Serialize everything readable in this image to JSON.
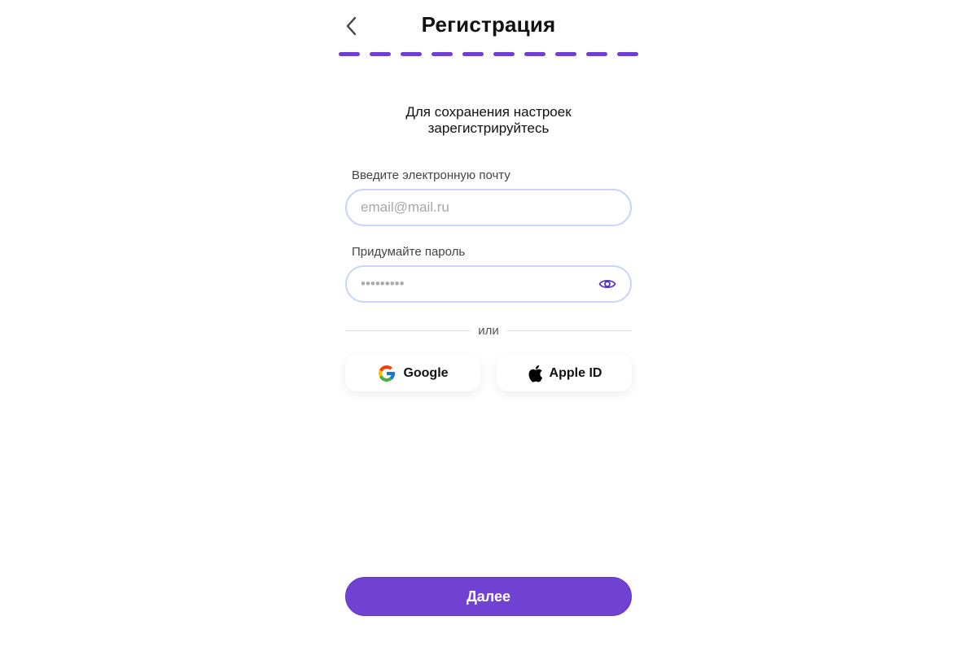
{
  "header": {
    "title": "Регистрация",
    "back_icon": "chevron-left-icon"
  },
  "progress": {
    "total_steps": 10,
    "completed_steps": 10,
    "color": "#6f3ed2"
  },
  "subtitle": {
    "line1": "Для сохранения настроек",
    "line2": "зарегистрируйтесь"
  },
  "email": {
    "label": "Введите электронную почту",
    "placeholder": "email@mail.ru",
    "value": ""
  },
  "password": {
    "label": "Придумайте пароль",
    "placeholder": "•••••••••",
    "value": "",
    "visibility_icon": "eye-icon"
  },
  "divider": {
    "text": "или"
  },
  "social": {
    "google_label": "Google",
    "google_icon": "google-icon",
    "apple_label": "Apple ID",
    "apple_icon": "apple-icon"
  },
  "actions": {
    "next_label": "Далее"
  },
  "colors": {
    "accent": "#7142d1",
    "field_border": "#c8d6f7",
    "text": "#111111"
  }
}
